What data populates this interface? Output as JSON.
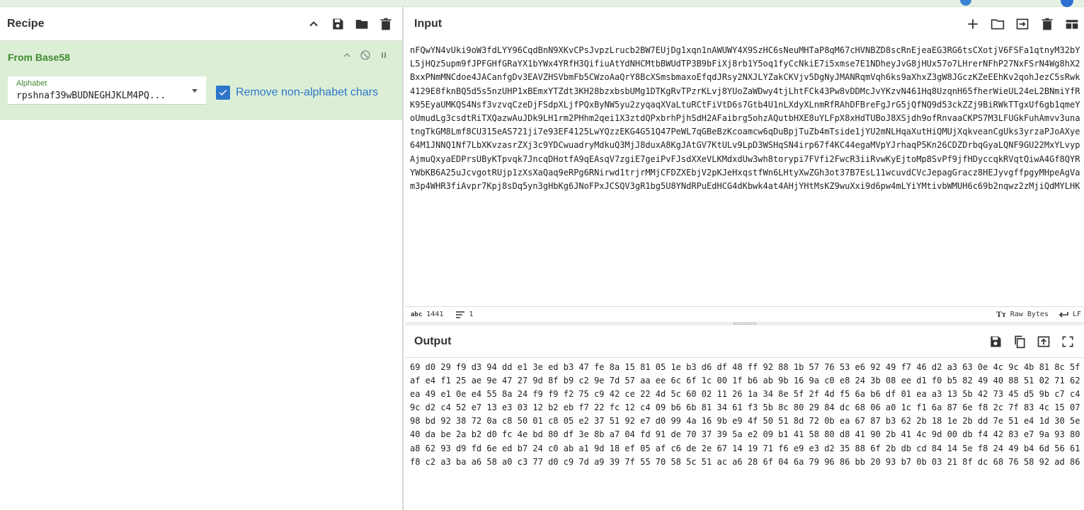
{
  "recipe": {
    "title": "Recipe",
    "tools": [
      "chevron-up-icon",
      "save-icon",
      "folder-icon",
      "trash-icon"
    ],
    "operation": {
      "name": "From Base58",
      "alphabet_label": "Alphabet",
      "alphabet_value": "rpshnaf39wBUDNEGHJKLM4PQ...",
      "remove_label": "Remove non-alphabet chars",
      "remove_checked": true
    }
  },
  "input": {
    "title": "Input",
    "text": "nFQwYN4vUki9oW3fdLYY96CqdBnN9XKvCPsJvpzLrucb2BW7EUjDg1xqn1nAWUWY4X9SzHC6sNeuMHTaP8qM67cHVNBZD8scRnEjeaEG3RG6tsCXotjV6FSFa1qtnyM32bYL5jHQz5upm9fJPFGHfGRaYX1bYWx4YRfH3QifiuAtYdNHCMtbBWUdTP3B9bFiXj8rb1Y5oq1fyCcNkiE7i5xmse7E1NDheyJvG8jHUx57o7LHrerNFhP27NxFSrN4Wg8hX2BxxPNmMNCdoe4JACanfgDv3EAVZHSVbmFb5CWzoAaQrY8BcXSmsbmaxoEfqdJRsy2NXJLYZakCKVjv5DgNyJMANRqmVqh6ks9aXhxZ3gW8JGczKZeEEhKv2qohJezC5sRwk4129E8fknBQ5d5s5nzUHP1xBEmxYTZdt3KH28bzxbsbUMg1DTKgRvTPzrKLvj8YUoZaWDwy4tjLhtFCk43Pw8vDDMcJvYKzvN461Hq8UzqnH65fherWieUL24eL2BNmiYfRK95EyaUMKQS4Nsf3vzvqCzeDjFSdpXLjfPQxByNW5yu2zyqaqXVaLtuRCtFiVtD6s7Gtb4U1nLXdyXLnmRfRAhDFBreFgJrG5jQfNQ9d53ckZZj9BiRWkTTgxUf6gb1qmeYoUmudLg3csdtRiTXQazwAuJDk9LH1rm2PHhm2qei1X3ztdQPxbrhPjhSdH2AFaibrg5ohzAQutbHXE8uYLFpX8xHdTUBoJ8XSjdh9ofRnvaaCKPS7M3LFUGkFuhAmvv3unatngTkGM8Lmf8CU315eAS721ji7e93EF4125LwYQzzEKG4G51Q47PeWL7qGBeBzKcoamcw6qDuBpjTuZb4mTside1jYU2mNLHqaXutHiQMUjXqkveanCgUks3yrzaPJoAXye64M1JNNQ1Nf7LbXKvzasrZXj3c9YDCwuadryMdkuQ3MjJ8duxA8KgJAtGV7KtULv9LpD3WSHqSN4irp67f4KC44egaMVpYJrhaqP5Kn26CDZDrbqGyaLQNF9GU22MxYLvypAjmuQxyaEDPrsUByKTpvqk7JncqDHotfA9qEAsqV7zgiE7geiPvFJsdXXeVLKMdxdUw3wh8torypi7FVfi2FwcR3iiRvwKyEjtoMp8SvPf9jfHDyccqkRVqtQiwA4Gf8QYRYWbKB6A25uJcvgotRUjp1zXsXaQaq9eRPg6RNirwd1trjrMMjCFDZXEbjV2pKJeHxqstfWn6LHtyXwZGh3ot37B7EsL11wcuvdCVcJepagGracz8HEJyvgffpgyMHpeAgVam3p4WHR3fiAvpr7Kpj8sDq5yn3gHbKg6JNoFPxJCSQV3gR1bg5U8YNdRPuEdHCG4dKbwk4at4AHjYHtMsKZ9wuXxi9d6pw4mLYiYMtivbWMUH6c69b2nqwz2zMjiQdMYLHK",
    "tools": [
      "plus-icon",
      "folder-icon",
      "import-icon",
      "trash-icon",
      "layout-icon"
    ],
    "status_length": "1441",
    "status_lines": "1",
    "status_format": "Raw Bytes",
    "status_eol": "LF",
    "abc_tag": "abc"
  },
  "output": {
    "title": "Output",
    "tools": [
      "save-icon",
      "copy-icon",
      "move-to-input-icon",
      "fullscreen-icon"
    ],
    "text": "69 d0 29 f9 d3 94 dd e1 3e ed b3 47 fe 8a 15 81 05 1e b3 d6 df 48 ff 92 88 1b 57 76 53 e6 92 49 f7 46 d2 a3 63 0e 4c 9c 4b 81 8c 5f af e4 f1 25 ae 9e 47 27 9d 8f b9 c2 9e 7d 57 aa ee 6c 6f 1c 00 1f b6 ab 9b 16 9a c0 e8 24 3b 08 ee d1 f0 b5 82 49 40 88 51 02 71 62 ea 49 e1 0e e4 55 8a 24 f9 f9 f2 75 c9 42 ce 22 4d 5c 60 02 11 26 1a 34 8e 5f 2f 4d f5 6a b6 df 01 ea a3 13 5b 42 73 45 d5 9b c7 c4 9c d2 c4 52 e7 13 e3 03 12 b2 eb f7 22 fc 12 c4 09 b6 6b 81 34 61 f3 5b 8c 80 29 84 dc 68 06 a0 1c f1 6a 87 6e f8 2c 7f 83 4c 15 07 98 bd 92 38 72 0a c8 50 01 c8 05 e2 37 51 92 e7 d0 99 4a 16 9b e9 4f 50 51 8d 72 0b ea 67 87 b3 62 2b 18 1e 2b dd 7e 51 e4 1d 30 5e 40 da be 2a b2 d0 fc 4e bd 80 df 3e 8b a7 04 fd 91 de 70 37 39 5a e2 09 b1 41 58 80 d8 41 90 2b 41 4c 9d 00 db f4 42 83 e7 9a 93 80 a8 62 93 d9 fd 6e ed b7 24 c0 ab a1 9d 18 ef 05 af c6 de 2e 67 14 19 71 f6 e9 e3 d2 35 88 6f 2b db cd 84 14 5e f8 24 49 b4 6d 56 61 f8 c2 a3 ba a6 58 a0 c3 77 d0 c9 7d a9 39 7f 55 70 58 5c 51 ac a6 28 6f 04 6a 79 96 86 bb 20 93 b7 0b 03 21 8f dc 68 76 58 92 ad 86"
  },
  "colors": {
    "accent_green": "#3e8a2f",
    "op_background": "#dcefd6",
    "checkbox_blue": "#2e76c9"
  }
}
